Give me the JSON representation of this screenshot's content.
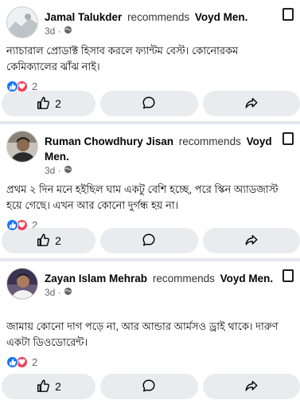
{
  "posts": [
    {
      "author": "Jamal Talukder",
      "action": "recommends",
      "page": "Voyd Men.",
      "time": "3d ·",
      "text": "ন্যাচারাল প্রোডাক্ট হিসাব করলে ফ্যান্টম বেস্ট। কোনোরকম কেমিক্যালের ঝাঁঝ নাই।",
      "reaction_count": "2",
      "like_count": "2"
    },
    {
      "author": "Ruman Chowdhury Jisan",
      "action": "recommends",
      "page": "Voyd Men.",
      "time": "3d ·",
      "text": "প্রথম ২ দিন মনে হইছিল ঘাম একটু বেশি হচ্ছে, পরে স্কিন অ্যাডজাস্ট হয়ে গেছে। এখন আর কোনো দুর্গন্ধ হয় না।",
      "reaction_count": "2",
      "like_count": "2"
    },
    {
      "author": "Zayan Islam Mehrab",
      "action": "recommends",
      "page": "Voyd Men.",
      "time": "3d ·",
      "text": "জামায় কোনো দাগ পড়ে না, আর আন্ডার আর্মসও ড্রাই থাকে। দারুণ একটা ডিওডোরেন্ট।",
      "reaction_count": "2",
      "like_count": "2"
    }
  ],
  "colors": {
    "like": "#1877f2",
    "love": "#f33e58",
    "muted": "#65676b",
    "button_bg": "#e9ebee",
    "feed_bg": "#e4e6eb"
  }
}
